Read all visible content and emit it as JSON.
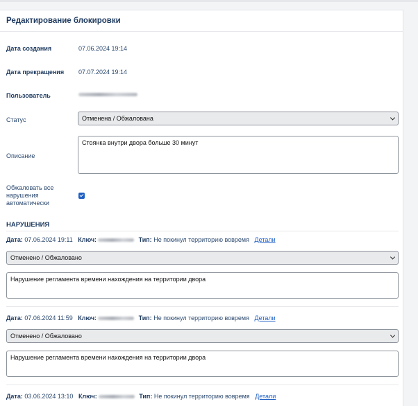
{
  "page_title": "Редактирование блокировки",
  "fields": {
    "created_label": "Дата создания",
    "created_value": "07.06.2024 19:14",
    "ended_label": "Дата прекращения",
    "ended_value": "07.07.2024 19:14",
    "user_label": "Пользователь",
    "status_label": "Статус",
    "status_value": "Отменена / Обжалована",
    "description_label": "Описание",
    "description_value": "Стоянка внутри двора больше 30 минут",
    "appeal_label": "Обжаловать все нарушения автоматически",
    "appeal_checked": true
  },
  "violations_section": {
    "title": "НАРУШЕНИЯ",
    "date_label": "Дата:",
    "key_label": "Ключ:",
    "type_label": "Тип:",
    "details_label": "Детали",
    "items": [
      {
        "date": "07.06.2024 19:11",
        "type": "Не покинул территорию вовремя",
        "status": "Отменено / Обжаловано",
        "comment": "Нарушение регламента времени нахождения на территории двора"
      },
      {
        "date": "07.06.2024 11:59",
        "type": "Не покинул территорию вовремя",
        "status": "Отменено / Обжаловано",
        "comment": "Нарушение регламента времени нахождения на территории двора"
      },
      {
        "date": "03.06.2024 13:10",
        "type": "Не покинул территорию вовремя"
      }
    ]
  }
}
